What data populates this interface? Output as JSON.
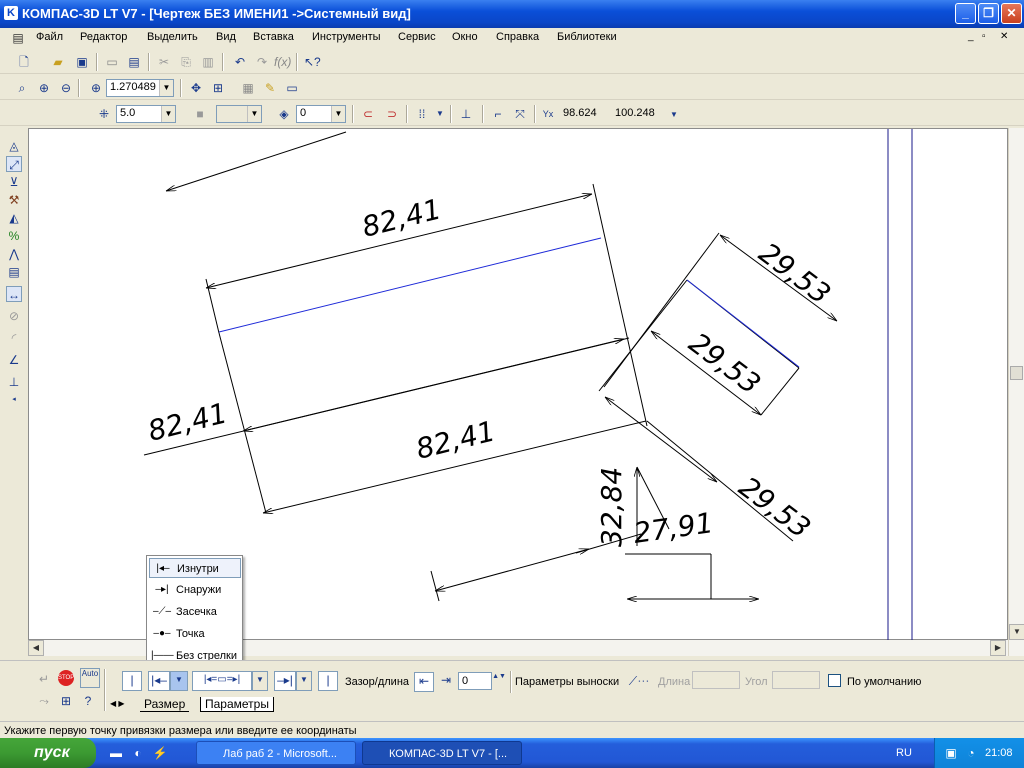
{
  "window": {
    "title": "КОМПАС-3D LT V7 - [Чертеж БЕЗ ИМЕНИ1 ->Системный вид]"
  },
  "menu": [
    "Файл",
    "Редактор",
    "Выделить",
    "Вид",
    "Вставка",
    "Инструменты",
    "Сервис",
    "Окно",
    "Справка",
    "Библиотеки"
  ],
  "toolbar2": {
    "zoom": "1.270489"
  },
  "toolbar3": {
    "step": "5.0",
    "layer": "0",
    "coord_y": "98.624",
    "coord_x": "100.248"
  },
  "drawing": {
    "dims": [
      "82,41",
      "82,41",
      "82,41",
      "29,53",
      "29,53",
      "29,53",
      "32,84",
      "27,91"
    ],
    "colors": {
      "line": "#000000",
      "axis": "#1e2ad8",
      "border": "#1a1a8a"
    }
  },
  "popup": {
    "items": [
      "Изнутри",
      "Снаружи",
      "Засечка",
      "Точка",
      "Без стрелки"
    ],
    "selected": "Изнутри"
  },
  "propbar": {
    "gap_label": "Зазор/длина",
    "gap_value": "0",
    "leader_label": "Параметры выноски",
    "length_label": "Длина",
    "angle_label": "Угол",
    "default_label": "По умолчанию",
    "tabs": [
      "Размер",
      "Параметры"
    ]
  },
  "status": "Укажите первую точку привязки размера или введите ее координаты",
  "taskbar": {
    "start": "пуск",
    "tasks": [
      "Лаб раб 2 - Microsoft...",
      "КОМПАС-3D LT V7 - [..."
    ],
    "lang": "RU",
    "time": "21:08"
  }
}
